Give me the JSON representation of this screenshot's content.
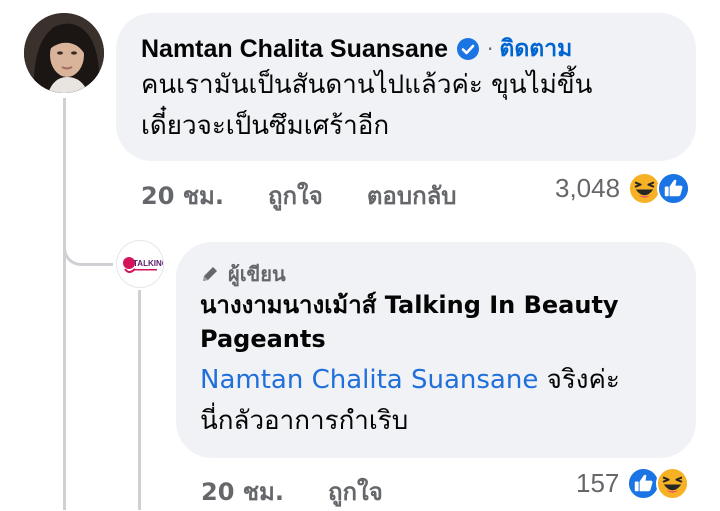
{
  "comment": {
    "author": "Namtan Chalita Suansane",
    "follow_label": "ติดตาม",
    "separator": "·",
    "text_line1": "คนเรามันเป็นสันดานไปแล้วค่ะ ขุนไม่ขึ้น",
    "text_line2": "เดี๋ยวจะเป็นซึมเศร้าอีก",
    "time": "20 ชม.",
    "like_label": "ถูกใจ",
    "reply_label": "ตอบกลับ",
    "reaction_count": "3,048",
    "reactions": [
      "haha-emoji",
      "like-emoji"
    ]
  },
  "reply": {
    "author_badge": "ผู้เขียน",
    "page_name_line1": "นางงามนางเม้าส์ Talking In Beauty",
    "page_name_line2": "Pageants",
    "mention": "Namtan Chalita Suansane",
    "text_after_mention": " จริงค่ะ",
    "text_line2": "นี่กลัวอาการกำเริบ",
    "time": "20 ชม.",
    "like_label": "ถูกใจ",
    "reaction_count": "157",
    "reactions": [
      "like-emoji",
      "haha-emoji"
    ],
    "logo_text": "TALKING"
  },
  "colors": {
    "bubble": "#f0f2f5",
    "link": "#216fdb",
    "follow": "#0064d1",
    "meta": "#65676b",
    "like_blue": "#1b74e4",
    "haha_yellow": "#f7b125"
  }
}
